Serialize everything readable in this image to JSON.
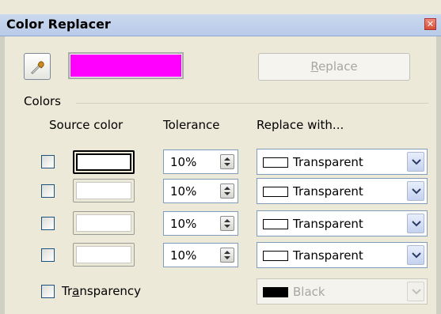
{
  "window": {
    "title": "Color Replacer",
    "close_glyph": "✕"
  },
  "toolbar": {
    "pipette_icon": "eyedropper-icon",
    "preview_color": "#ff00ff",
    "replace_label_pre": "",
    "replace_label_u": "R",
    "replace_label_post": "eplace"
  },
  "colors_group": {
    "label": "Colors",
    "headers": {
      "source": "Source color",
      "tolerance": "Tolerance",
      "replace_with": "Replace with..."
    },
    "rows": [
      {
        "checked": false,
        "tolerance": "10%",
        "replace_with": "Transparent",
        "active": true
      },
      {
        "checked": false,
        "tolerance": "10%",
        "replace_with": "Transparent",
        "active": false
      },
      {
        "checked": false,
        "tolerance": "10%",
        "replace_with": "Transparent",
        "active": false
      },
      {
        "checked": false,
        "tolerance": "10%",
        "replace_with": "Transparent",
        "active": false
      }
    ]
  },
  "transparency": {
    "label_pre": "Tr",
    "label_u": "a",
    "label_post": "nsparency",
    "color": "Black"
  }
}
